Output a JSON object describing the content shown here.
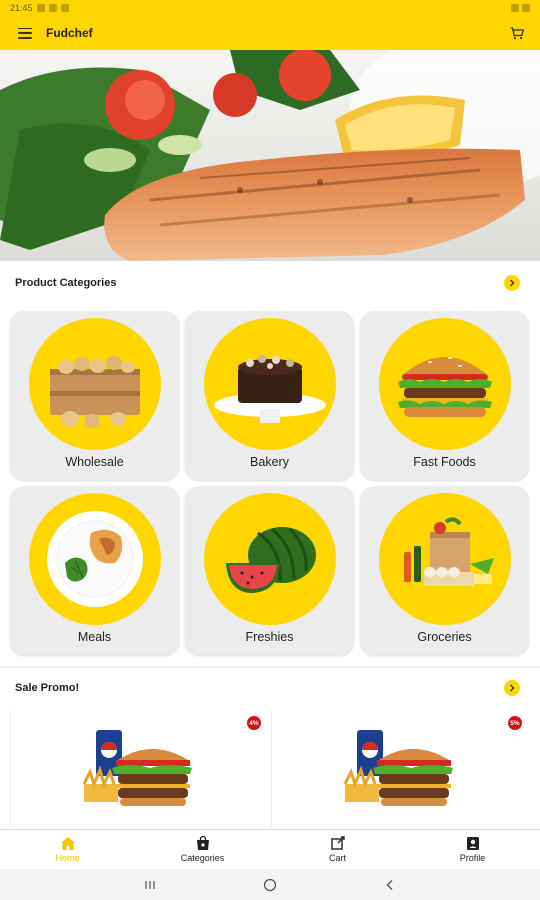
{
  "status_bar": {
    "time": "21:45"
  },
  "app_bar": {
    "title": "Fudchef",
    "menu_icon": "hamburger-menu-icon",
    "cart_icon": "cart-icon"
  },
  "hero": {
    "image": "grilled-salmon-salad-photo"
  },
  "categories_section": {
    "title": "Product Categories",
    "items": [
      {
        "label": "Wholesale",
        "icon": "potato-crate-image"
      },
      {
        "label": "Bakery",
        "icon": "chocolate-cake-image"
      },
      {
        "label": "Fast Foods",
        "icon": "burger-image"
      },
      {
        "label": "Meals",
        "icon": "plated-meal-image"
      },
      {
        "label": "Freshies",
        "icon": "watermelon-image"
      },
      {
        "label": "Groceries",
        "icon": "grocery-bag-image"
      }
    ]
  },
  "promo_section": {
    "title": "Sale Promo!",
    "items": [
      {
        "badge": "4%",
        "image": "burger-combo-image"
      },
      {
        "badge": "5%",
        "image": "burger-combo-image"
      }
    ]
  },
  "bottom_nav": {
    "items": [
      {
        "label": "Home",
        "icon": "home-icon",
        "active": true
      },
      {
        "label": "Categories",
        "icon": "shopping-bag-icon",
        "active": false
      },
      {
        "label": "Cart",
        "icon": "cart-icon",
        "active": false
      },
      {
        "label": "Profile",
        "icon": "profile-icon",
        "active": false
      }
    ]
  },
  "colors": {
    "brand": "#ffd700",
    "badge": "#d0101b",
    "card": "#ececec"
  }
}
